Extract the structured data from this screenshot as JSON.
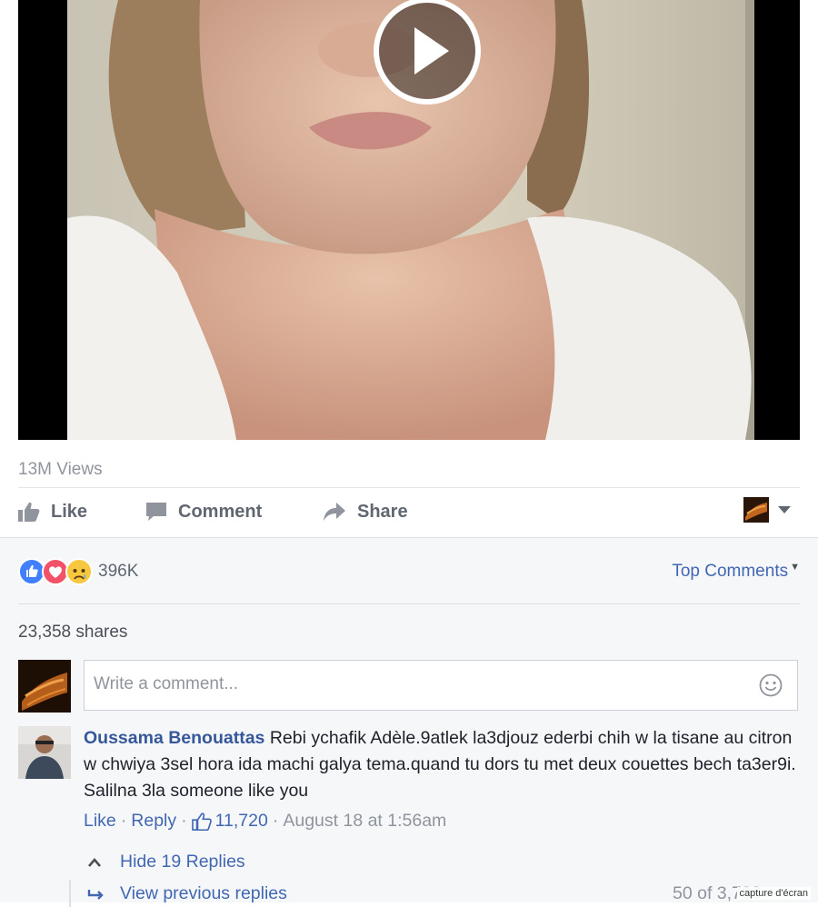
{
  "video": {
    "play_icon": "play-icon"
  },
  "stats": {
    "views": "13M Views"
  },
  "actions": {
    "like": "Like",
    "comment": "Comment",
    "share": "Share"
  },
  "reactions": {
    "types": [
      "like-icon",
      "love-icon",
      "sad-icon"
    ],
    "count": "396K"
  },
  "sort": {
    "label": "Top Comments"
  },
  "shares": "23,358 shares",
  "composer": {
    "placeholder": "Write a comment..."
  },
  "comment": {
    "author": "Oussama Benouattas",
    "text": "Rebi ychafik Adèle.9atlek la3djouz ederbi chih w la tisane au citron w chwiya 3sel hora ida machi galya tema.quand tu dors tu met deux couettes bech ta3er9i. Salilna 3la someone like you",
    "like_label": "Like",
    "reply_label": "Reply",
    "like_count": "11,720",
    "timestamp": "August 18 at 1:56am"
  },
  "replies": {
    "hide_label": "Hide 19 Replies",
    "view_previous_label": "View previous replies",
    "count_label": "50 of 3,700"
  },
  "watermark": "capture d'écran",
  "colors": {
    "link": "#4267b2",
    "author": "#365899",
    "like_blue": "#4080ff",
    "love_red": "#f25268",
    "sad_yellow": "#f7c83f"
  }
}
